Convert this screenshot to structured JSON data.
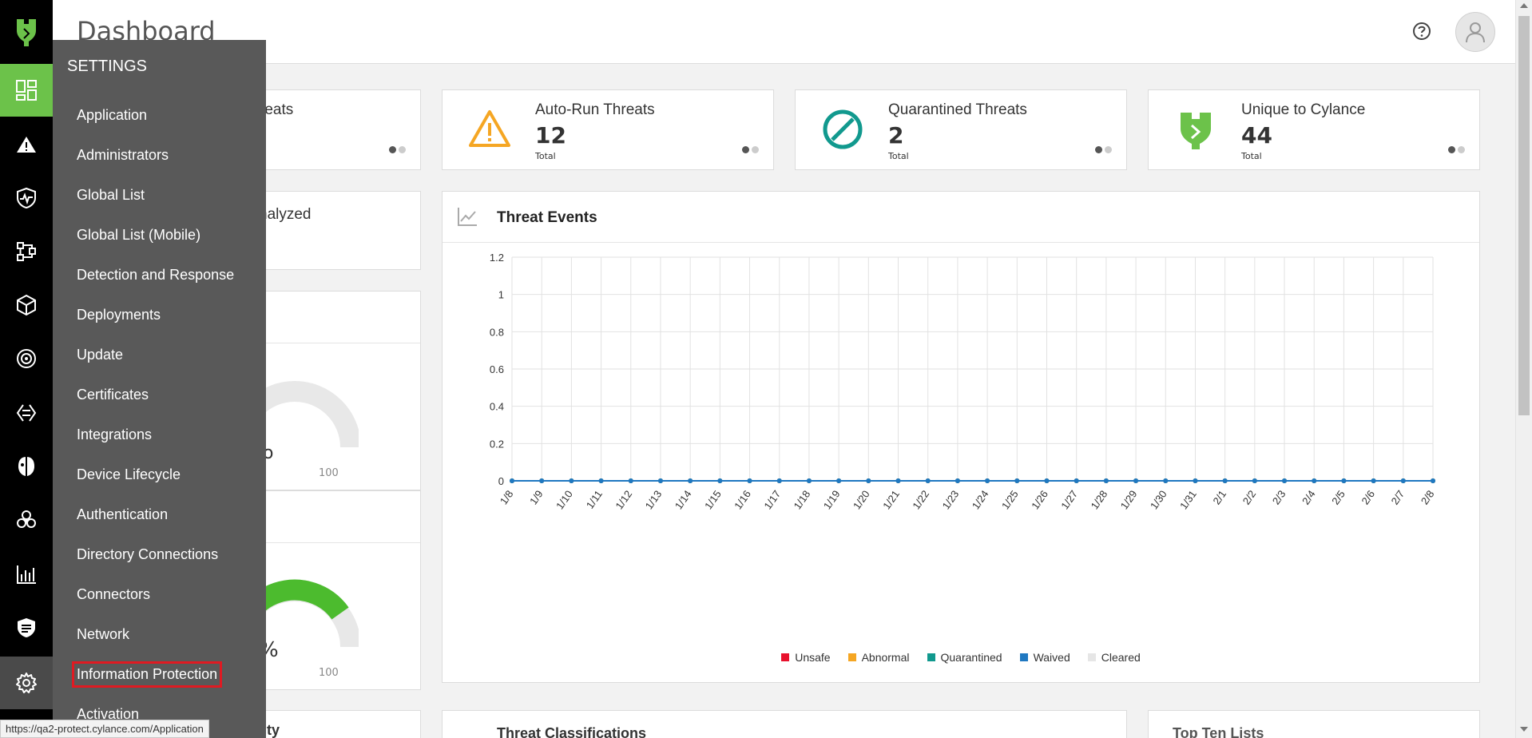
{
  "header": {
    "title": "Dashboard"
  },
  "rail": {
    "items": [
      {
        "name": "dashboard",
        "icon": "dashboard-icon",
        "active": true
      },
      {
        "name": "alerts",
        "icon": "warning-icon"
      },
      {
        "name": "protection",
        "icon": "shield-pulse-icon"
      },
      {
        "name": "zones",
        "icon": "network-nodes-icon"
      },
      {
        "name": "devices",
        "icon": "cube-icon"
      },
      {
        "name": "optics",
        "icon": "target-icon"
      },
      {
        "name": "policies",
        "icon": "chevrons-icon"
      },
      {
        "name": "persona",
        "icon": "mask-icon"
      },
      {
        "name": "protect-mobile",
        "icon": "biohazard-icon"
      },
      {
        "name": "reports",
        "icon": "bar-chart-icon"
      },
      {
        "name": "gateway",
        "icon": "shield-list-icon"
      },
      {
        "name": "settings",
        "icon": "gear-icon"
      }
    ]
  },
  "stats": [
    {
      "title": "Unsafe Threats",
      "title_visible": "reats",
      "value": "",
      "sub": ""
    },
    {
      "title": "Auto-Run Threats",
      "value": "12",
      "sub": "Total",
      "icon": "warning-triangle-icon"
    },
    {
      "title": "Quarantined Threats",
      "value": "2",
      "sub": "Total",
      "icon": "quarantine-icon"
    },
    {
      "title": "Unique to Cylance",
      "value": "44",
      "sub": "Total",
      "icon": "cylance-logo-icon"
    }
  ],
  "partial": {
    "analyzed": "nalyzed",
    "gauge1_max": "100",
    "gauge1_value": "o",
    "gauge2_max": "100",
    "gauge2_value": "%",
    "bottom_left": "ty"
  },
  "chart_data": {
    "type": "line",
    "title": "Threat Events",
    "x": [
      "1/8",
      "1/9",
      "1/10",
      "1/11",
      "1/12",
      "1/13",
      "1/14",
      "1/15",
      "1/16",
      "1/17",
      "1/18",
      "1/19",
      "1/20",
      "1/21",
      "1/22",
      "1/23",
      "1/24",
      "1/25",
      "1/26",
      "1/27",
      "1/28",
      "1/29",
      "1/30",
      "1/31",
      "2/1",
      "2/2",
      "2/3",
      "2/4",
      "2/5",
      "2/6",
      "2/7",
      "2/8"
    ],
    "ylim": [
      0,
      1.2
    ],
    "yticks": [
      "1.2",
      "1",
      "0.8",
      "0.6",
      "0.4",
      "0.2",
      "0"
    ],
    "grid": true,
    "legend_position": "bottom",
    "series": [
      {
        "name": "Unsafe",
        "color": "#e8112d",
        "values": [
          0,
          0,
          0,
          0,
          0,
          0,
          0,
          0,
          0,
          0,
          0,
          0,
          0,
          0,
          0,
          0,
          0,
          0,
          0,
          0,
          0,
          0,
          0,
          0,
          0,
          0,
          0,
          0,
          0,
          0,
          0,
          0
        ]
      },
      {
        "name": "Abnormal",
        "color": "#f5a623",
        "values": [
          0,
          0,
          0,
          0,
          0,
          0,
          0,
          0,
          0,
          0,
          0,
          0,
          0,
          0,
          0,
          0,
          0,
          0,
          0,
          0,
          0,
          0,
          0,
          0,
          0,
          0,
          0,
          0,
          0,
          0,
          0,
          0
        ]
      },
      {
        "name": "Quarantined",
        "color": "#11998e",
        "values": [
          0,
          0,
          0,
          0,
          0,
          0,
          0,
          0,
          0,
          0,
          0,
          0,
          0,
          0,
          0,
          0,
          0,
          0,
          0,
          0,
          0,
          0,
          0,
          0,
          0,
          0,
          0,
          0,
          0,
          0,
          0,
          0
        ]
      },
      {
        "name": "Waived",
        "color": "#1f78c1",
        "values": [
          0,
          0,
          0,
          0,
          0,
          0,
          0,
          0,
          0,
          0,
          0,
          0,
          0,
          0,
          0,
          0,
          0,
          0,
          0,
          0,
          0,
          0,
          0,
          0,
          0,
          0,
          0,
          0,
          0,
          0,
          0,
          0
        ]
      },
      {
        "name": "Cleared",
        "color": "#e6e6e6",
        "values": [
          0,
          0,
          0,
          0,
          0,
          0,
          0,
          0,
          0,
          0,
          0,
          0,
          0,
          0,
          0,
          0,
          0,
          0,
          0,
          0,
          0,
          0,
          0,
          0,
          0,
          0,
          0,
          0,
          0,
          0,
          0,
          0
        ]
      }
    ]
  },
  "bottom": {
    "classifications": "Threat Classifications",
    "top_ten": "Top Ten Lists"
  },
  "settings_menu": {
    "title": "SETTINGS",
    "items": [
      "Application",
      "Administrators",
      "Global List",
      "Global List (Mobile)",
      "Detection and Response",
      "Deployments",
      "Update",
      "Certificates",
      "Integrations",
      "Device Lifecycle",
      "Authentication",
      "Directory Connections",
      "Connectors",
      "Network",
      "Information Protection",
      "Activation"
    ],
    "highlighted": "Information Protection"
  },
  "status_bar": {
    "url": "https://qa2-protect.cylance.com/Application"
  }
}
